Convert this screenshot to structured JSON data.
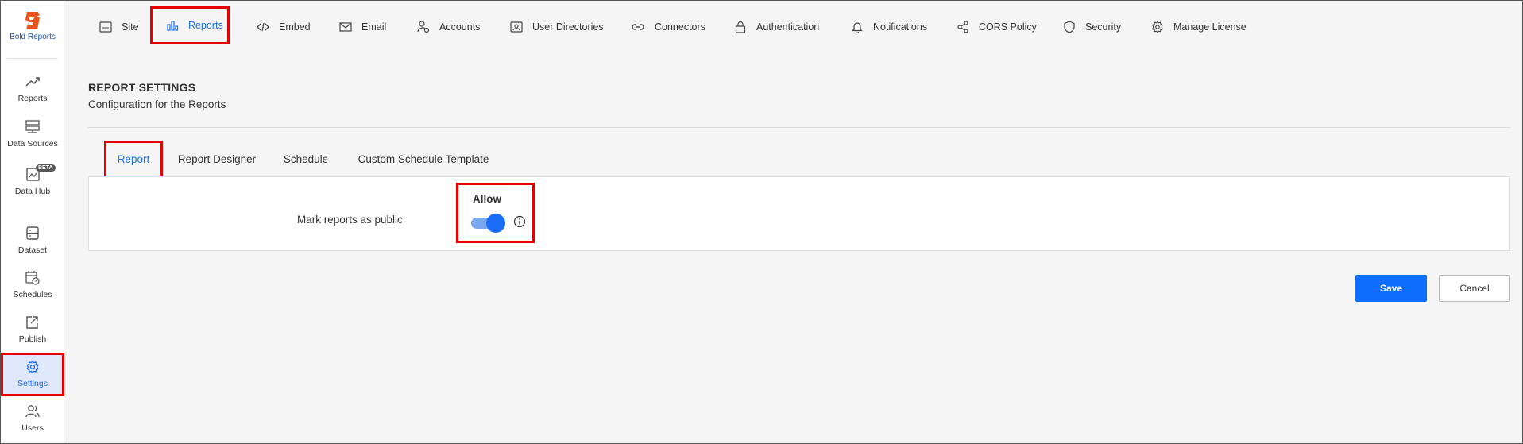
{
  "brand": {
    "name": "Bold Reports",
    "color": "#e8541e"
  },
  "accent": "#1a6ef5",
  "sidebar": {
    "items": [
      {
        "label": "Reports",
        "icon": "trend-chart-icon"
      },
      {
        "label": "Data Sources",
        "icon": "data-sources-icon"
      },
      {
        "label": "Data Hub",
        "icon": "data-hub-icon",
        "badge": "BETA"
      },
      {
        "label": "Dataset",
        "icon": "dataset-icon"
      },
      {
        "label": "Schedules",
        "icon": "calendar-clock-icon"
      },
      {
        "label": "Publish",
        "icon": "publish-icon"
      },
      {
        "label": "Settings",
        "icon": "gear-icon",
        "active": true
      },
      {
        "label": "Users",
        "icon": "users-icon"
      }
    ]
  },
  "topnav": {
    "items": [
      {
        "label": "Site",
        "icon": "site-url-icon"
      },
      {
        "label": "Reports",
        "icon": "bar-chart-icon",
        "active": true
      },
      {
        "label": "Embed",
        "icon": "code-icon"
      },
      {
        "label": "Email",
        "icon": "envelope-icon"
      },
      {
        "label": "Accounts",
        "icon": "account-gear-icon"
      },
      {
        "label": "User Directories",
        "icon": "contact-card-icon"
      },
      {
        "label": "Connectors",
        "icon": "link-icon"
      },
      {
        "label": "Authentication",
        "icon": "lock-icon"
      },
      {
        "label": "Notifications",
        "icon": "bell-icon"
      },
      {
        "label": "CORS Policy",
        "icon": "share-nodes-icon"
      },
      {
        "label": "Security",
        "icon": "shield-icon"
      },
      {
        "label": "Manage License",
        "icon": "license-gear-icon"
      }
    ]
  },
  "page": {
    "title": "REPORT SETTINGS",
    "subtitle": "Configuration for the Reports"
  },
  "tabs": [
    {
      "label": "Report",
      "active": true
    },
    {
      "label": "Report Designer"
    },
    {
      "label": "Schedule"
    },
    {
      "label": "Custom Schedule Template"
    }
  ],
  "settings": {
    "public_label": "Mark reports as public",
    "allow_label": "Allow",
    "public_enabled": true
  },
  "buttons": {
    "save": "Save",
    "cancel": "Cancel"
  }
}
